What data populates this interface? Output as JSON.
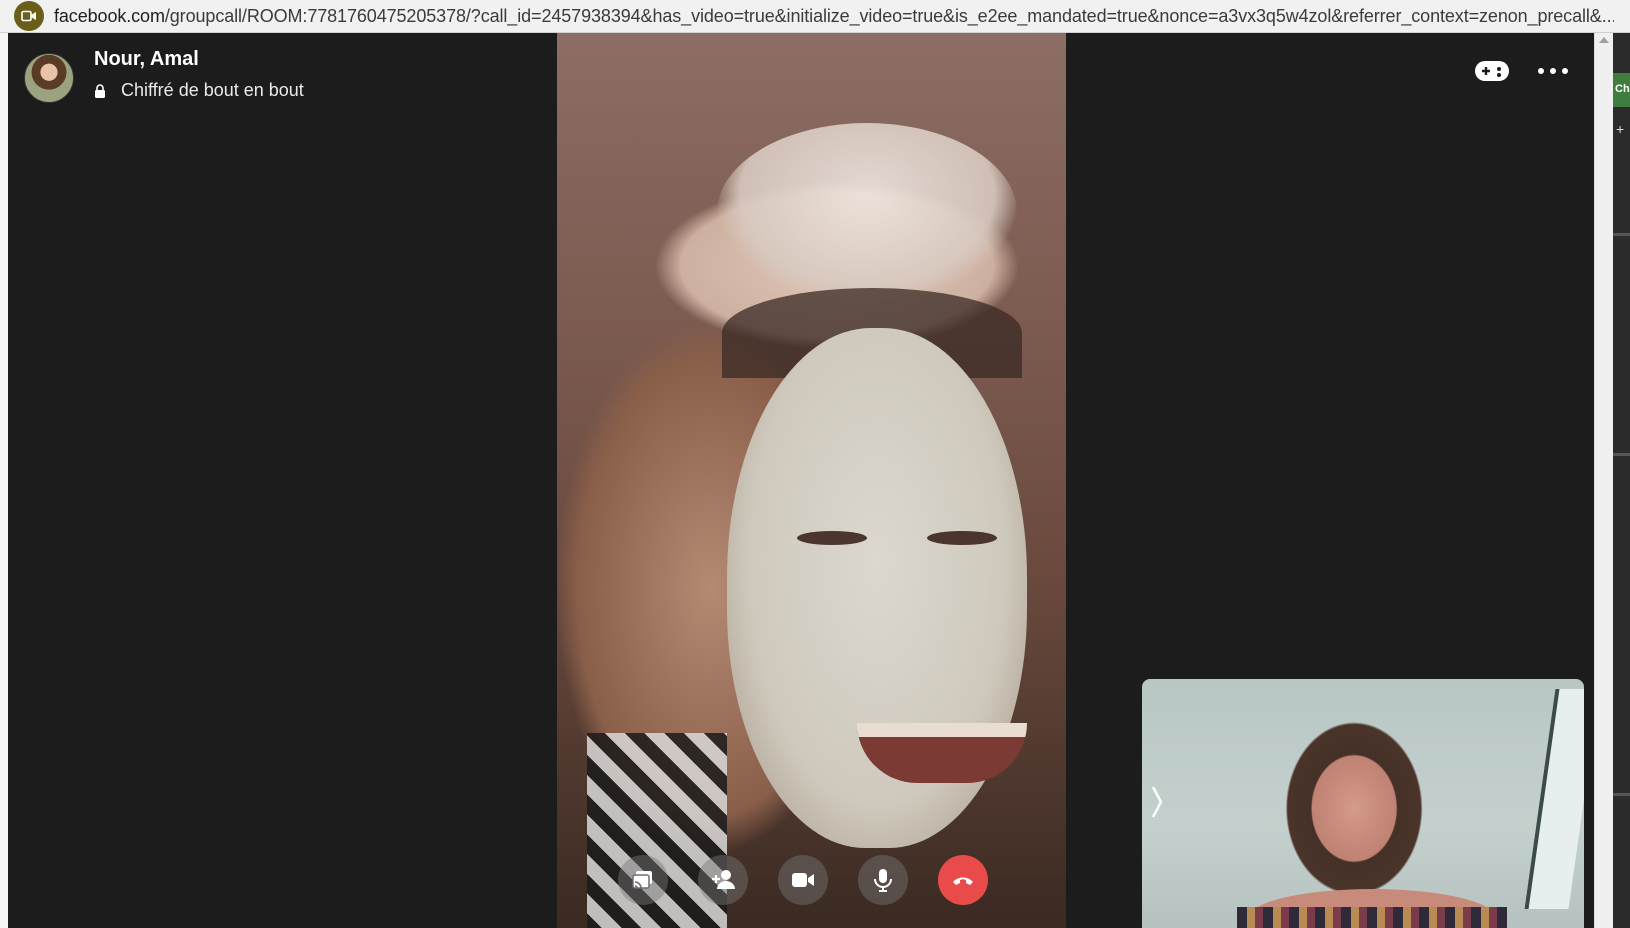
{
  "browser": {
    "url_host": "facebook.com",
    "url_rest": "/groupcall/ROOM:7781760475205378/?call_id=2457938394&has_video=true&initialize_video=true&is_e2ee_mandated=true&nonce=a3vx3q5w4zol&referrer_context=zenon_precall&..."
  },
  "header": {
    "caller_name": "Nour, Amal",
    "encryption_label": "Chiffré de bout en bout"
  },
  "sidebar_sliver": {
    "tab_label": "Ch",
    "plus": "+"
  },
  "controls": [
    {
      "name": "share-screen",
      "icon": "share-screen-icon"
    },
    {
      "name": "add-person",
      "icon": "add-person-icon"
    },
    {
      "name": "camera",
      "icon": "video-camera-icon"
    },
    {
      "name": "microphone",
      "icon": "microphone-icon"
    },
    {
      "name": "end-call",
      "icon": "hang-up-icon"
    }
  ],
  "colors": {
    "end_call": "#e94b4b",
    "background": "#1c1c1c"
  }
}
